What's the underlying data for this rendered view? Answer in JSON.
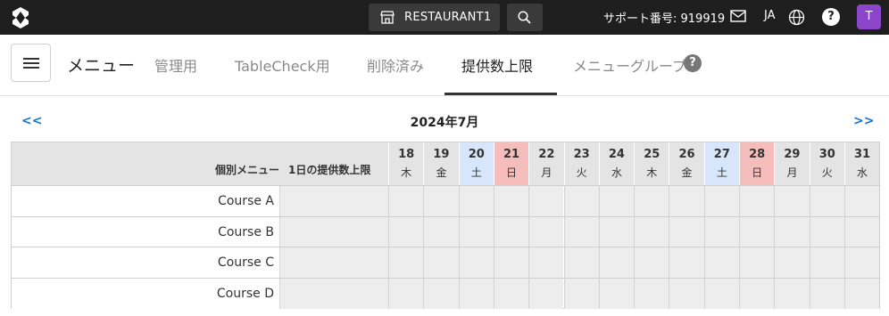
{
  "topbar": {
    "restaurant_label": "RESTAURANT1",
    "support_text": "サポート番号: 919919",
    "language": "JA",
    "help_glyph": "?",
    "avatar_initial": "T",
    "avatar_color": "#8a45c9"
  },
  "nav": {
    "title": "メニュー",
    "tabs": [
      {
        "label": "管理用",
        "active": false
      },
      {
        "label": "TableCheck用",
        "active": false
      },
      {
        "label": "削除済み",
        "active": false
      },
      {
        "label": "提供数上限",
        "active": true
      },
      {
        "label": "メニューグループ",
        "active": false
      }
    ],
    "help_glyph": "?"
  },
  "calendar": {
    "prev_label": "<<",
    "next_label": ">>",
    "month_title": "2024年7月",
    "col_menu_label": "個別メニュー",
    "col_limit_label": "1日の提供数上限",
    "days": [
      {
        "num": "18",
        "dow": "木",
        "type": "weekday"
      },
      {
        "num": "19",
        "dow": "金",
        "type": "weekday"
      },
      {
        "num": "20",
        "dow": "土",
        "type": "sat"
      },
      {
        "num": "21",
        "dow": "日",
        "type": "sun"
      },
      {
        "num": "22",
        "dow": "月",
        "type": "weekday"
      },
      {
        "num": "23",
        "dow": "火",
        "type": "weekday"
      },
      {
        "num": "24",
        "dow": "水",
        "type": "weekday"
      },
      {
        "num": "25",
        "dow": "木",
        "type": "weekday"
      },
      {
        "num": "26",
        "dow": "金",
        "type": "weekday"
      },
      {
        "num": "27",
        "dow": "土",
        "type": "sat"
      },
      {
        "num": "28",
        "dow": "日",
        "type": "sun"
      },
      {
        "num": "29",
        "dow": "月",
        "type": "weekday"
      },
      {
        "num": "30",
        "dow": "火",
        "type": "weekday"
      },
      {
        "num": "31",
        "dow": "水",
        "type": "weekday"
      }
    ],
    "rows": [
      {
        "name": "Course A"
      },
      {
        "name": "Course B"
      },
      {
        "name": "Course C"
      },
      {
        "name": "Course D"
      }
    ]
  },
  "colors": {
    "saturday": "#d7e6fa",
    "sunday": "#f6bdbd",
    "link": "#1a73c8"
  }
}
